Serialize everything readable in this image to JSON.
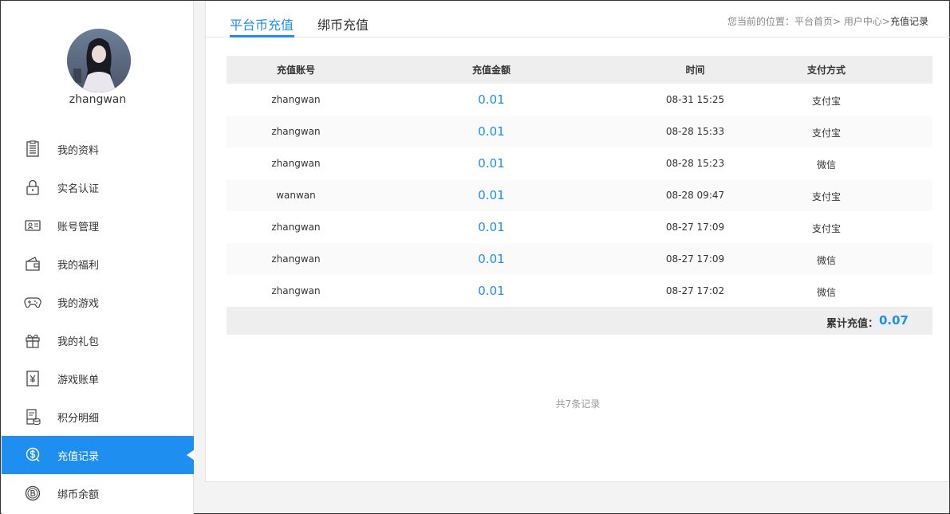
{
  "user": {
    "name": "zhangwan"
  },
  "sidebar": {
    "items": [
      {
        "label": "我的资料",
        "icon": "document-list-icon"
      },
      {
        "label": "实名认证",
        "icon": "lock-icon"
      },
      {
        "label": "账号管理",
        "icon": "id-card-icon"
      },
      {
        "label": "我的福利",
        "icon": "wallet-icon"
      },
      {
        "label": "我的游戏",
        "icon": "gamepad-icon"
      },
      {
        "label": "我的礼包",
        "icon": "gift-icon"
      },
      {
        "label": "游戏账单",
        "icon": "yen-bill-icon"
      },
      {
        "label": "积分明细",
        "icon": "points-detail-icon"
      },
      {
        "label": "充值记录",
        "icon": "dollar-circle-icon",
        "active": true
      },
      {
        "label": "绑币余额",
        "icon": "coin-b-icon"
      }
    ]
  },
  "tabs": [
    {
      "label": "平台币充值",
      "active": true
    },
    {
      "label": "绑币充值",
      "active": false
    }
  ],
  "breadcrumb": {
    "prefix": "您当前的位置：",
    "home": "平台首页",
    "sep": ">",
    "center": "用户中心",
    "current": "充值记录"
  },
  "table": {
    "headers": [
      "充值账号",
      "充值金额",
      "时间",
      "支付方式"
    ],
    "rows": [
      {
        "account": "zhangwan",
        "amount": "0.01",
        "time": "08-31 15:25",
        "method": "支付宝"
      },
      {
        "account": "zhangwan",
        "amount": "0.01",
        "time": "08-28 15:33",
        "method": "支付宝"
      },
      {
        "account": "zhangwan",
        "amount": "0.01",
        "time": "08-28 15:23",
        "method": "微信"
      },
      {
        "account": "wanwan",
        "amount": "0.01",
        "time": "08-28 09:47",
        "method": "支付宝"
      },
      {
        "account": "zhangwan",
        "amount": "0.01",
        "time": "08-27 17:09",
        "method": "支付宝"
      },
      {
        "account": "zhangwan",
        "amount": "0.01",
        "time": "08-27 17:09",
        "method": "微信"
      },
      {
        "account": "zhangwan",
        "amount": "0.01",
        "time": "08-27 17:02",
        "method": "微信"
      }
    ],
    "summary_label": "累计充值：",
    "summary_value": "0.07"
  },
  "footer": {
    "total_records": "共7条记录"
  },
  "colors": {
    "accent": "#1e8ff0",
    "header_bg": "#eeeeee"
  }
}
